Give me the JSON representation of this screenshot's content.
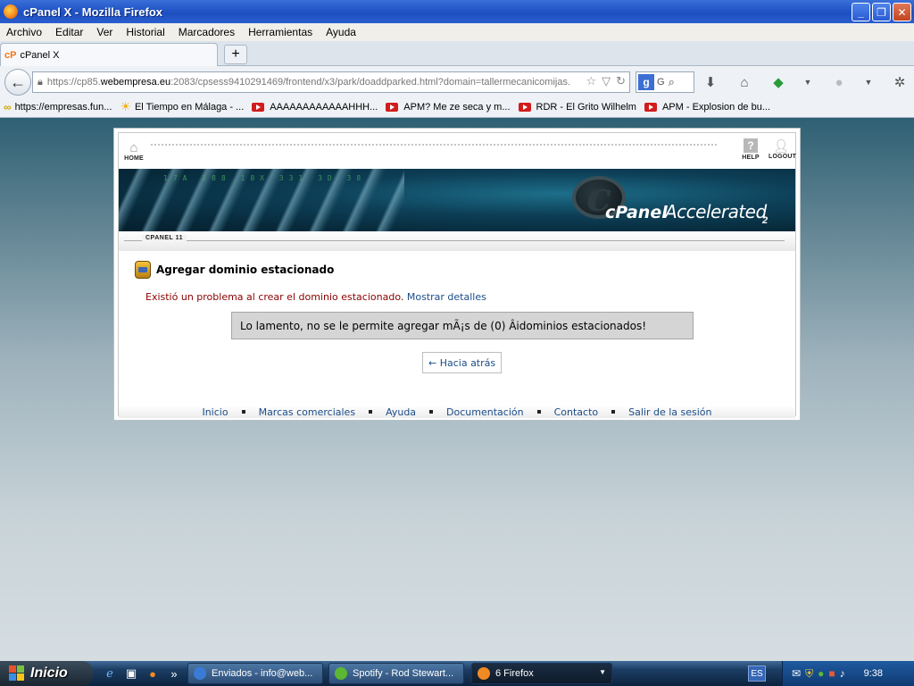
{
  "window": {
    "title": "cPanel X - Mozilla Firefox",
    "buttons": {
      "minimize": "_",
      "maximize": "❐",
      "close": "✕"
    }
  },
  "menubar": [
    "Archivo",
    "Editar",
    "Ver",
    "Historial",
    "Marcadores",
    "Herramientas",
    "Ayuda"
  ],
  "tab": {
    "favicon": "cP",
    "label": "cPanel X",
    "new_tab": "+"
  },
  "navbar": {
    "url_pre": "https://cp85.",
    "url_host": "webempresa.eu",
    "url_post": ":2083/cpsess9410291469/frontend/x3/park/doaddparked.html?domain=tallermecanicomijas.",
    "search_text": "G"
  },
  "bookmarks": [
    {
      "icon": "link-icon",
      "label": "https://empresas.fun..."
    },
    {
      "icon": "sun-icon",
      "label": "El Tiempo en Málaga - ..."
    },
    {
      "icon": "youtube-icon",
      "label": "AAAAAAAAAAAAHHH..."
    },
    {
      "icon": "youtube-icon",
      "label": "APM? Me ze seca y m..."
    },
    {
      "icon": "youtube-icon",
      "label": "RDR - El Grito Wilhelm"
    },
    {
      "icon": "youtube-icon",
      "label": "APM - Explosion de bu..."
    }
  ],
  "cpanel": {
    "home_label": "HOME",
    "help_label": "HELP",
    "logout_label": "LOGOUT",
    "help_glyph": "?",
    "version": "CPANEL 11",
    "brand_c": "cPanel",
    "brand_accel": "Accelerated",
    "brand_num": "2",
    "banner_digits": "17A 188 18X 331 3D 38",
    "heading": "Agregar dominio estacionado",
    "error_text": "Existió un problema al crear el dominio estacionado.",
    "details_link": "Mostrar detalles",
    "message": "Lo lamento, no se le permite agregar mÃ¡s de (0) Âidominios estacionados!",
    "back_link": "← Hacia atrás",
    "footer": [
      "Inicio",
      "Marcas comerciales",
      "Ayuda",
      "Documentación",
      "Contacto",
      "Salir de la sesión"
    ]
  },
  "taskbar": {
    "start_label": "Inicio",
    "tasks": [
      {
        "label": "Enviados - info@web...",
        "icon_color": "#3b7bd8"
      },
      {
        "label": "Spotify - Rod Stewart...",
        "icon_color": "#5cb832"
      },
      {
        "label": "6 Firefox",
        "icon_color": "#f08a22"
      }
    ],
    "quick_more": "»",
    "lang": "ES",
    "clock": "9:38"
  }
}
